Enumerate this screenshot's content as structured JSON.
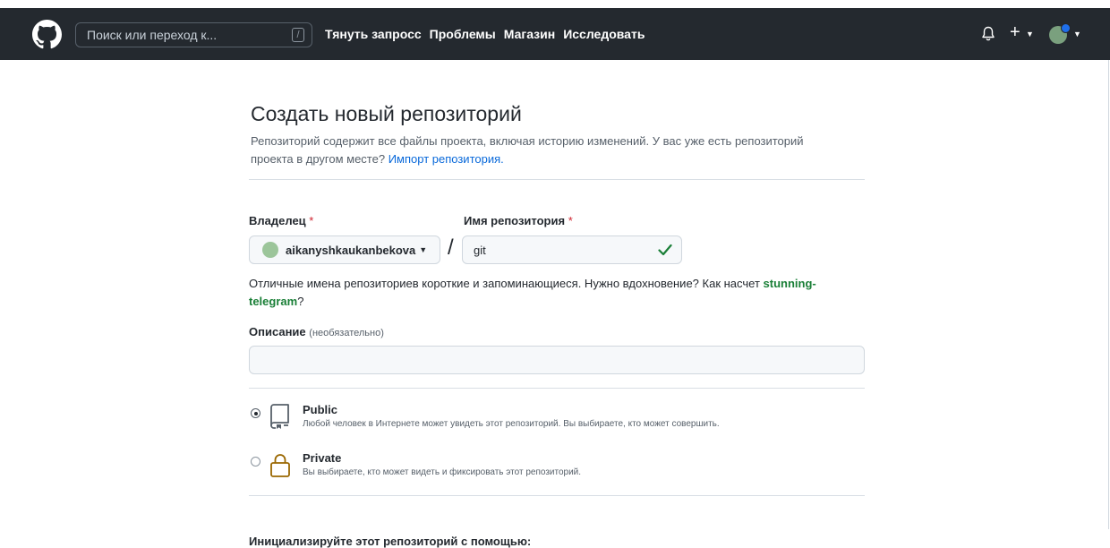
{
  "header": {
    "search_placeholder": "Поиск или переход к...",
    "search_shortcut": "/",
    "nav": [
      "Тянуть запросс",
      "Проблемы",
      "Магазин",
      "Исследовать"
    ],
    "plus_label": "+",
    "icons": [
      "github-logo-icon",
      "bell-icon",
      "plus-icon",
      "avatar"
    ]
  },
  "form": {
    "title": "Создать новый репозиторий",
    "subtitle": "Репозиторий содержит все файлы проекта, включая историю изменений. У вас уже есть репозиторий проекта в другом месте?",
    "import_link": "Импорт репозитория.",
    "owner_label": "Владелец",
    "required_mark": "*",
    "owner_value": "aikanyshkaukanbekova",
    "slash": "/",
    "name_label": "Имя репозитория",
    "name_value": "git",
    "hint_text": "Отличные имена репозиториев короткие и запоминающиеся. Нужно вдохновение? Как насчет",
    "hint_suggestion": "stunning-telegram",
    "hint_end": "?",
    "description_label": "Описание",
    "description_optional": "(необязательно)",
    "description_value": "",
    "visibility": [
      {
        "title": "Public",
        "description": "Любой человек в Интернете может увидеть этот репозиторий. Вы выбираете, кто может совершить.",
        "selected": true
      },
      {
        "title": "Private",
        "description": "Вы выбираете, кто может видеть и фиксировать этот репозиторий.",
        "selected": false
      }
    ],
    "init_title": "Инициализируйте этот репозиторий с помощью:"
  },
  "colors": {
    "header_bg": "#24292f",
    "link": "#0969da",
    "success": "#1a7f37",
    "required": "#cf222e",
    "private_icon": "#9a6700"
  }
}
